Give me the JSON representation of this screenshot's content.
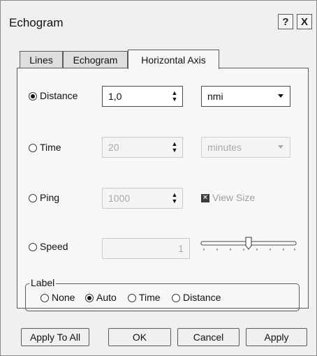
{
  "window": {
    "title": "Echogram"
  },
  "titlebar_buttons": {
    "help": "?",
    "close": "X"
  },
  "tabs": [
    {
      "label": "Lines",
      "active": false
    },
    {
      "label": "Echogram",
      "active": false
    },
    {
      "label": "Horizontal Axis",
      "active": true
    }
  ],
  "axis": {
    "distance": {
      "label": "Distance",
      "selected": true,
      "value": "1,0",
      "unit": "nmi"
    },
    "time": {
      "label": "Time",
      "selected": false,
      "value": "20",
      "unit": "minutes"
    },
    "ping": {
      "label": "Ping",
      "selected": false,
      "value": "1000",
      "view_size_label": "View Size",
      "view_size_checked": true
    },
    "speed": {
      "label": "Speed",
      "selected": false,
      "value": "1",
      "slider_level": 0.5
    }
  },
  "label_group": {
    "title": "Label",
    "options": [
      {
        "label": "None",
        "selected": false
      },
      {
        "label": "Auto",
        "selected": true
      },
      {
        "label": "Time",
        "selected": false
      },
      {
        "label": "Distance",
        "selected": false
      }
    ]
  },
  "buttons": {
    "apply_to_all": "Apply To All",
    "ok": "OK",
    "cancel": "Cancel",
    "apply": "Apply"
  },
  "icons": {
    "spin_up": "▲",
    "spin_down": "▼",
    "check": "✕"
  }
}
